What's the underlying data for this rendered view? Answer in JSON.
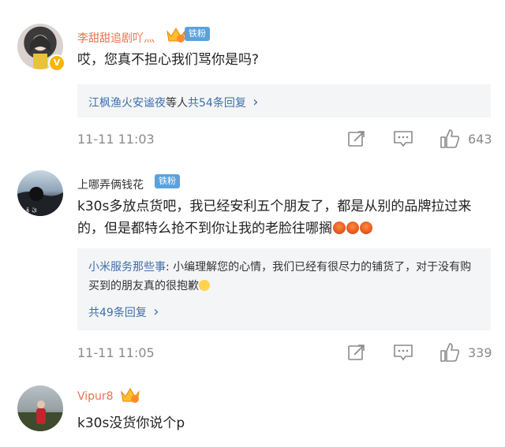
{
  "comments": [
    {
      "username": "李甜甜追剧吖灬",
      "fan_badge": "铁粉",
      "text": "哎，您真不担心我们骂你是吗?",
      "reply_summary": {
        "names": "江枫渔火安谧夜",
        "suffix": "等人",
        "count_text": "共54条回复",
        "chevron": "›"
      },
      "time": "11-11 11:03",
      "likes": "643"
    },
    {
      "username": "上哪弄俩钱花",
      "fan_badge": "铁粉",
      "text": "k30s多放点货吧，我已经安利五个朋友了，都是从别的品牌拉过来的，但是都特么抢不到你让我的老脸往哪搁",
      "reply": {
        "author": "小米服务那些事",
        "text": ": 小编理解您的心情，我们已经有很尽力的铺货了，对于没有购买到的朋友真的很抱歉",
        "count_text": "共49条回复",
        "chevron": "›"
      },
      "time": "11-11 11:05",
      "likes": "339"
    },
    {
      "username": "Vipur8",
      "text": "k30s没货你说个p"
    }
  ],
  "icons": {
    "share": "share-icon",
    "comment": "comment-icon",
    "like": "thumbs-up-icon"
  },
  "colors": {
    "username_highlight": "#eb7350",
    "link_blue": "#3d6fa9",
    "fan_badge_bg": "#5aa2dc",
    "meta_gray": "#8a8a8a"
  }
}
